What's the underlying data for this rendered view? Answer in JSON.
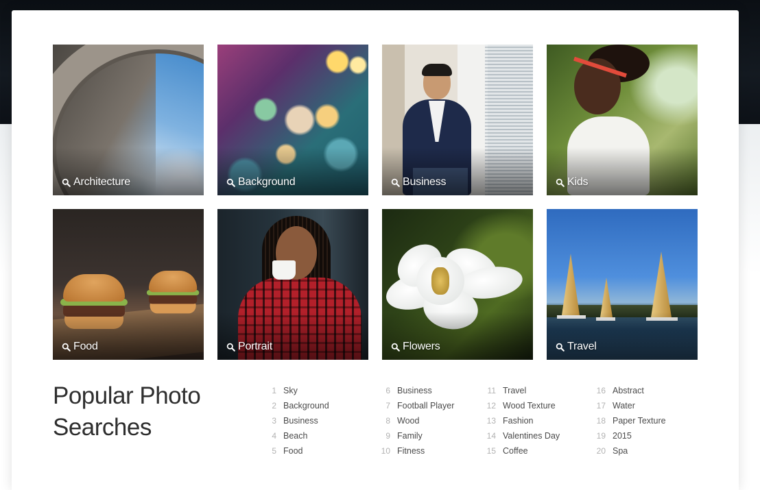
{
  "categories": [
    {
      "label": "Architecture",
      "icon": "search-icon"
    },
    {
      "label": "Background",
      "icon": "search-icon"
    },
    {
      "label": "Business",
      "icon": "search-icon"
    },
    {
      "label": "Kids",
      "icon": "search-icon"
    },
    {
      "label": "Food",
      "icon": "search-icon"
    },
    {
      "label": "Portrait",
      "icon": "search-icon"
    },
    {
      "label": "Flowers",
      "icon": "search-icon"
    },
    {
      "label": "Travel",
      "icon": "search-icon"
    }
  ],
  "popular": {
    "title": "Popular Photo Searches",
    "items": [
      {
        "num": "1",
        "label": "Sky"
      },
      {
        "num": "2",
        "label": "Background"
      },
      {
        "num": "3",
        "label": "Business"
      },
      {
        "num": "4",
        "label": "Beach"
      },
      {
        "num": "5",
        "label": "Food"
      },
      {
        "num": "6",
        "label": "Business"
      },
      {
        "num": "7",
        "label": "Football Player"
      },
      {
        "num": "8",
        "label": "Wood"
      },
      {
        "num": "9",
        "label": "Family"
      },
      {
        "num": "10",
        "label": "Fitness"
      },
      {
        "num": "11",
        "label": "Travel"
      },
      {
        "num": "12",
        "label": "Wood Texture"
      },
      {
        "num": "13",
        "label": "Fashion"
      },
      {
        "num": "14",
        "label": "Valentines Day"
      },
      {
        "num": "15",
        "label": "Coffee"
      },
      {
        "num": "16",
        "label": "Abstract"
      },
      {
        "num": "17",
        "label": "Water"
      },
      {
        "num": "18",
        "label": "Paper Texture"
      },
      {
        "num": "19",
        "label": "2015"
      },
      {
        "num": "20",
        "label": "Spa"
      }
    ]
  },
  "colors": {
    "title_text": "#2e2e2e",
    "item_text": "#4a4a4a",
    "item_number": "#b2b2b2",
    "card_bg": "#ffffff"
  }
}
